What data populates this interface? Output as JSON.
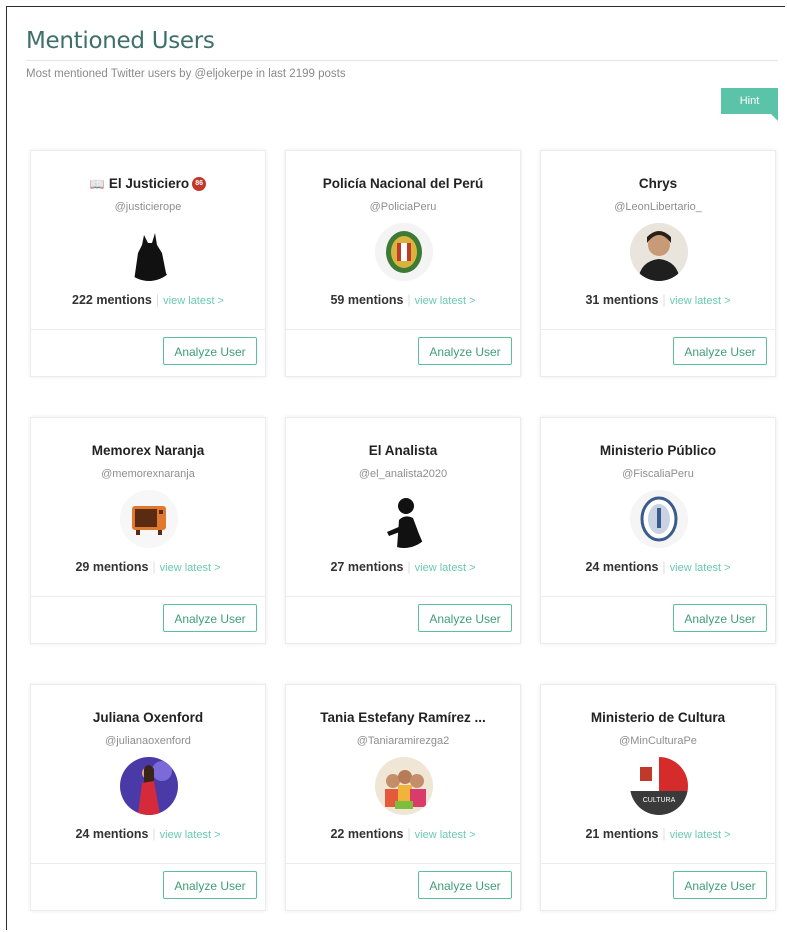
{
  "header": {
    "title": "Mentioned Users",
    "subtitle": "Most mentioned Twitter users by @eljokerpe in last 2199 posts",
    "hint_label": "Hint"
  },
  "common": {
    "view_latest": "view latest >",
    "analyze_label": "Analyze User",
    "separator": "|"
  },
  "users": [
    {
      "name": "El Justiciero",
      "prefix_icon": "book-icon",
      "badge": "86",
      "handle": "@justicierope",
      "mentions": "222 mentions",
      "avatar": "batman-silhouette"
    },
    {
      "name": "Policía Nacional del Perú",
      "handle": "@PoliciaPeru",
      "mentions": "59 mentions",
      "avatar": "police-crest"
    },
    {
      "name": "Chrys",
      "handle": "@LeonLibertario_",
      "mentions": "31 mentions",
      "avatar": "person-photo"
    },
    {
      "name": "Memorex Naranja",
      "handle": "@memorexnaranja",
      "mentions": "29 mentions",
      "avatar": "orange-tv"
    },
    {
      "name": "El Analista",
      "handle": "@el_analista2020",
      "mentions": "27 mentions",
      "avatar": "thinker-silhouette"
    },
    {
      "name": "Ministerio Público",
      "handle": "@FiscaliaPeru",
      "mentions": "24 mentions",
      "avatar": "fiscalia-seal"
    },
    {
      "name": "Juliana Oxenford",
      "handle": "@julianaoxenford",
      "mentions": "24 mentions",
      "avatar": "woman-red-dress"
    },
    {
      "name": "Tania Estefany Ramírez ...",
      "handle": "@Taniaramirezga2",
      "mentions": "22 mentions",
      "avatar": "group-photo"
    },
    {
      "name": "Ministerio de Cultura",
      "handle": "@MinCulturaPe",
      "mentions": "21 mentions",
      "avatar": "cultura-logo",
      "avatar_text": "CULTURA"
    }
  ],
  "colors": {
    "accent": "#5bc4a8",
    "title": "#3f6f6b",
    "button_border": "#5bbf9a"
  }
}
